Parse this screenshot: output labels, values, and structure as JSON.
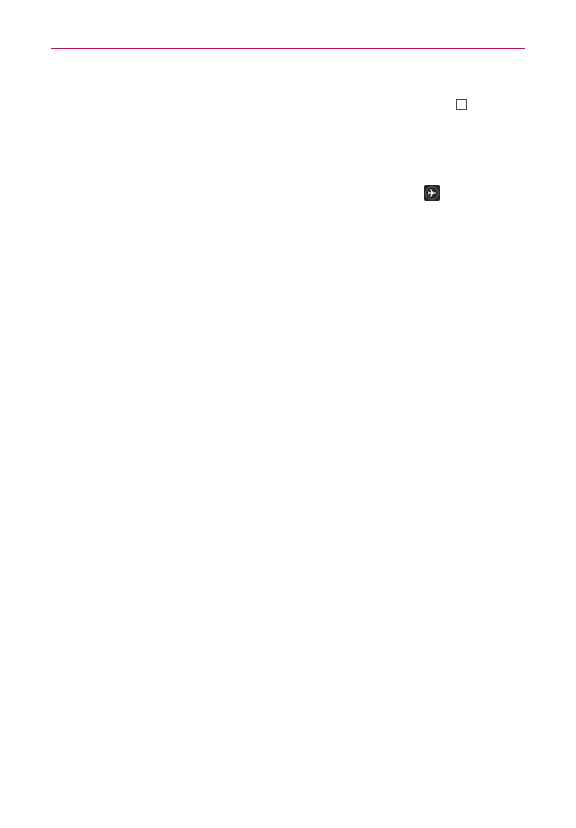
{
  "page": {
    "accent_color": "#b5175f",
    "background_color": "#ffffff"
  },
  "icons": {
    "checkbox": {
      "name": "checkbox-icon",
      "state": "unchecked"
    },
    "airplane_mode": {
      "name": "airplane-mode-icon",
      "background_color": "#262626",
      "glyph_color": "#ffffff"
    }
  }
}
